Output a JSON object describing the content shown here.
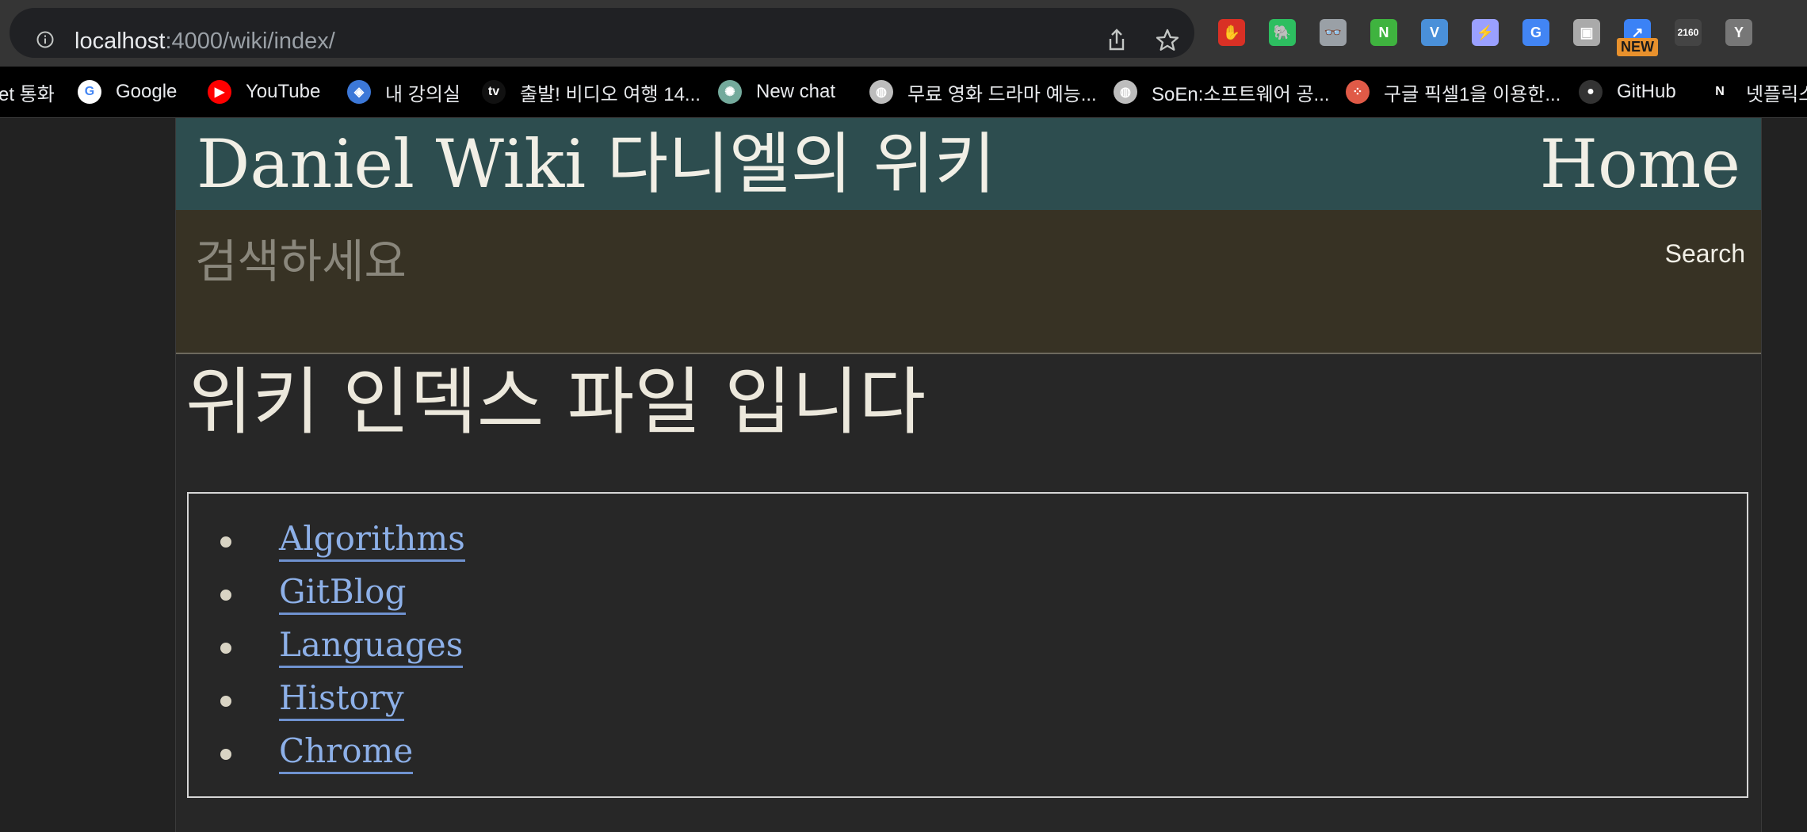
{
  "browser": {
    "url_host": "localhost",
    "url_path": ":4000/wiki/index/",
    "extensions": [
      {
        "name": "adblock-icon",
        "color": "#d93025",
        "label": "✋"
      },
      {
        "name": "evernote-icon",
        "color": "#2dbe60",
        "label": "🐘"
      },
      {
        "name": "readers-icon",
        "color": "#9aa0a6",
        "label": "👓"
      },
      {
        "name": "naver-icon",
        "color": "#3fb33f",
        "label": "N"
      },
      {
        "name": "vivaldi-icon",
        "color": "#4a90d9",
        "label": "V"
      },
      {
        "name": "feather-icon",
        "color": "#9aa0ff",
        "label": "⚡"
      },
      {
        "name": "translate-icon",
        "color": "#4285f4",
        "label": "G"
      },
      {
        "name": "capture-icon",
        "color": "#aaaaaa",
        "label": "▣"
      },
      {
        "name": "share-ext-icon",
        "color": "#3b82f6",
        "label": "↗"
      },
      {
        "name": "counter-icon",
        "color": "#444444",
        "label": "2160"
      },
      {
        "name": "y-icon",
        "color": "#777777",
        "label": "Y"
      }
    ],
    "new_badge": "NEW",
    "bookmarks": [
      {
        "label": "et 통화",
        "icon": "",
        "icon_name": "call-icon",
        "color": "#000000"
      },
      {
        "label": "Google",
        "icon": "G",
        "icon_name": "google-icon",
        "color": "#ffffff"
      },
      {
        "label": "YouTube",
        "icon": "▶",
        "icon_name": "youtube-icon",
        "color": "#ff0000"
      },
      {
        "label": "내 강의실",
        "icon": "◈",
        "icon_name": "classroom-icon",
        "color": "#3c78d8"
      },
      {
        "label": "출발! 비디오 여행 14...",
        "icon": "tv",
        "icon_name": "tv-icon",
        "color": "#111111"
      },
      {
        "label": "New chat",
        "icon": "✺",
        "icon_name": "chatgpt-icon",
        "color": "#74aa9c"
      },
      {
        "label": "무료 영화 드라마 예능...",
        "icon": "◍",
        "icon_name": "globe-icon",
        "color": "#bdbdbd"
      },
      {
        "label": "SoEn:소프트웨어 공...",
        "icon": "◍",
        "icon_name": "globe-icon-2",
        "color": "#bdbdbd"
      },
      {
        "label": "구글 픽셀1을 이용한...",
        "icon": "⁘",
        "icon_name": "dots-icon",
        "color": "#e05a47"
      },
      {
        "label": "GitHub",
        "icon": "●",
        "icon_name": "github-icon",
        "color": "#333333"
      },
      {
        "label": "넷플릭스",
        "icon": "N",
        "icon_name": "netflix-icon",
        "color": "#000000"
      }
    ]
  },
  "site": {
    "title": "Daniel Wiki 다니엘의 위키",
    "home_label": "Home"
  },
  "search": {
    "placeholder": "검색하세요",
    "button_label": "Search"
  },
  "main": {
    "title": "위키 인덱스 파일 입니다",
    "links": [
      "Algorithms",
      "GitBlog",
      "Languages",
      "History",
      "Chrome"
    ]
  }
}
